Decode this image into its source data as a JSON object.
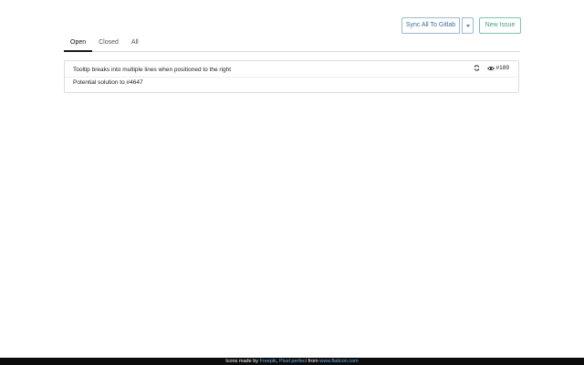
{
  "toolbar": {
    "sync_label": "Sync All To Gitlab",
    "new_issue_label": "New Issue"
  },
  "tabs": [
    {
      "label": "Open",
      "active": true
    },
    {
      "label": "Closed",
      "active": false
    },
    {
      "label": "All",
      "active": false
    }
  ],
  "issues": [
    {
      "title": "Tooltip breaks into multiple lines when positioned to the right",
      "body": "Potential solution to #4647",
      "number": "#189",
      "icons": [
        "sync-icon",
        "eye-icon"
      ]
    }
  ],
  "footer": {
    "prefix": "Icons made by ",
    "author1": "Freepik",
    "sep": ", ",
    "author2": "Pixel perfect",
    "from": " from ",
    "site": "www.flaticon.com"
  },
  "colors": {
    "primary_border": "#9fb8d0",
    "primary_text": "#3b6f9a",
    "success_border": "#7fc4b0",
    "success_text": "#43a184",
    "footer_bg": "#0c0c0c",
    "footer_link": "#6fb4ef"
  }
}
